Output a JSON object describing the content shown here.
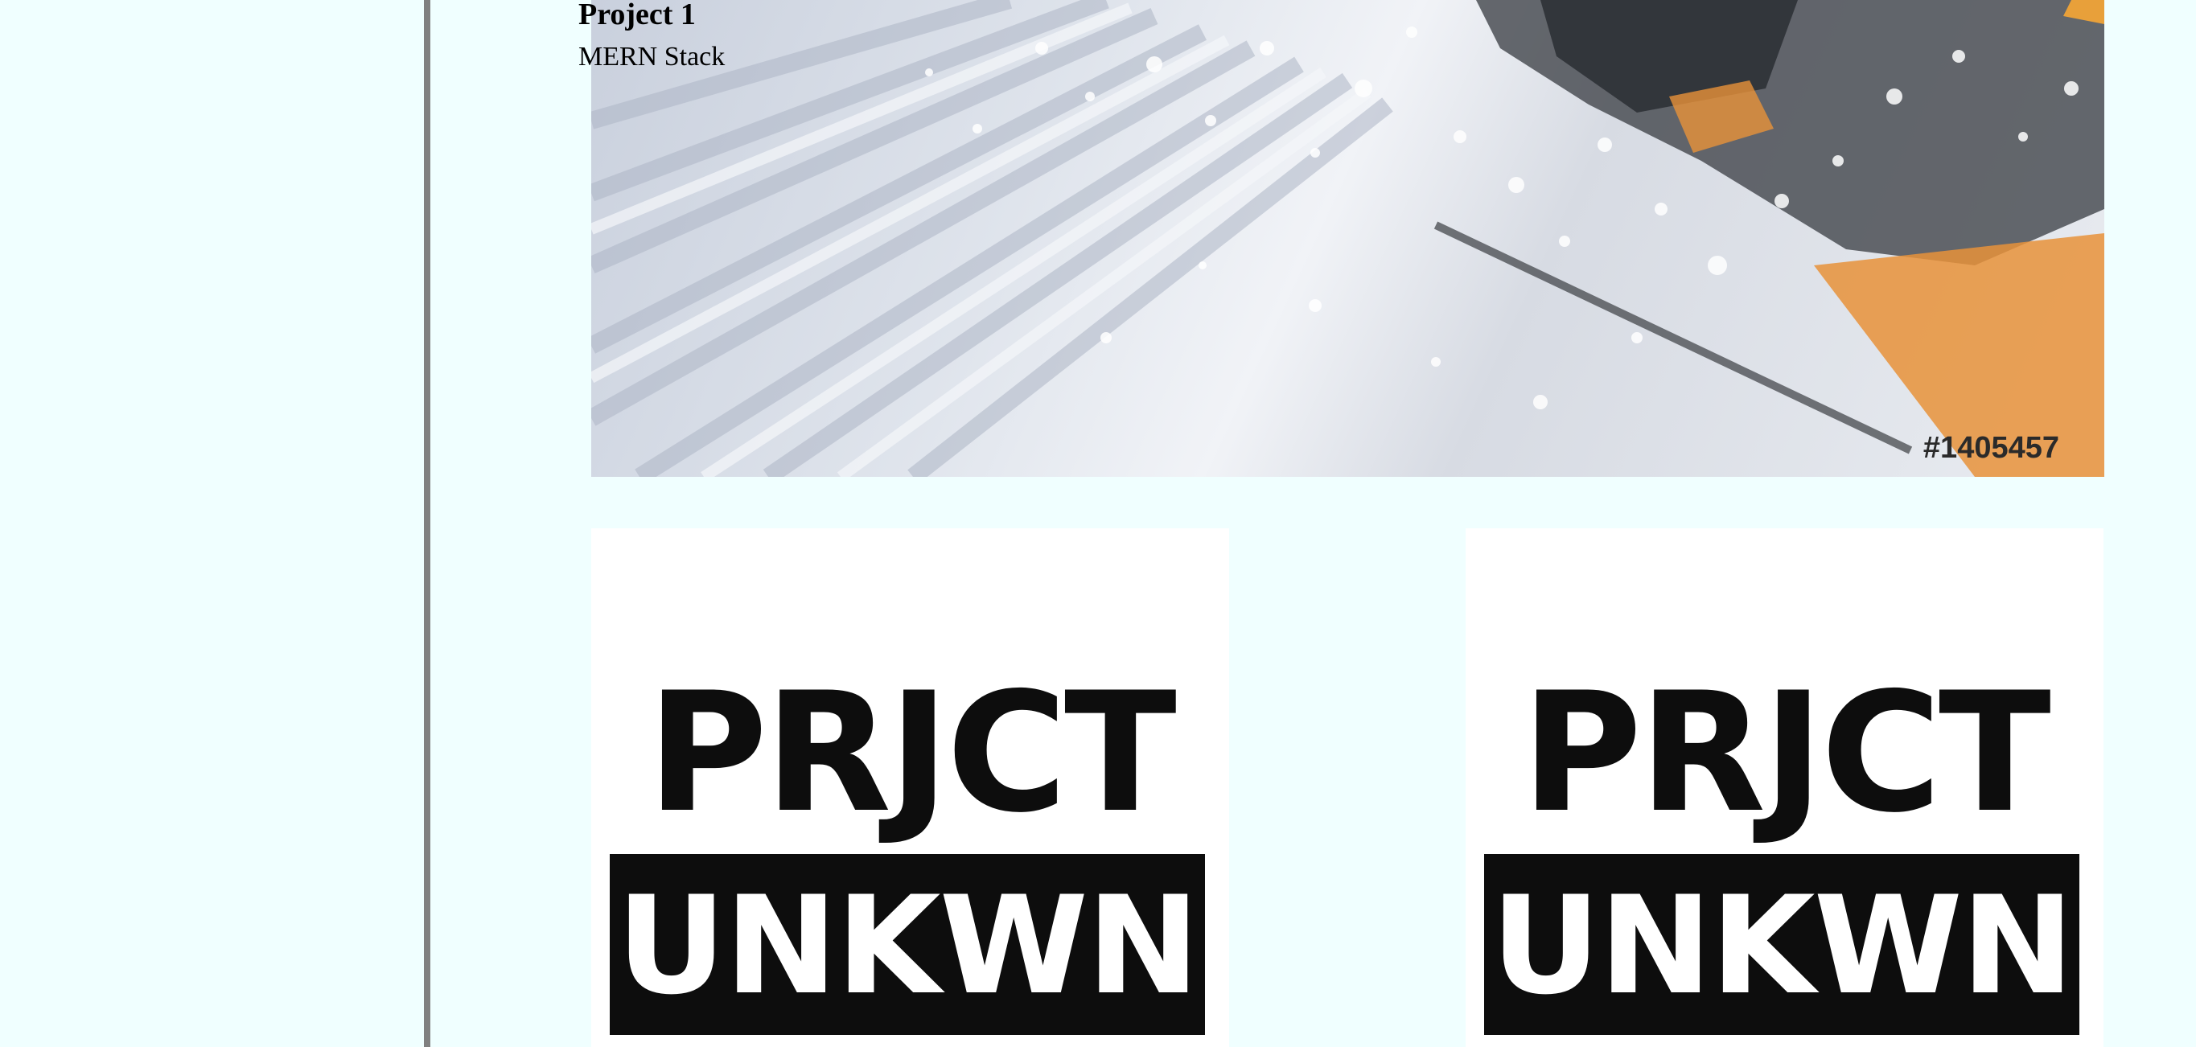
{
  "project": {
    "title": "Project 1",
    "subtitle": "MERN Stack"
  },
  "hero": {
    "image_id": "#1405457"
  },
  "logos": [
    {
      "top_text": "PRJCT",
      "bottom_text": "UNKWN"
    },
    {
      "top_text": "PRJCT",
      "bottom_text": "UNKWN"
    }
  ],
  "colors": {
    "page_background": "#f0ffff",
    "divider": "#808080",
    "logo_ink": "#0d0d0d",
    "hero_accent": "#e8923a"
  }
}
